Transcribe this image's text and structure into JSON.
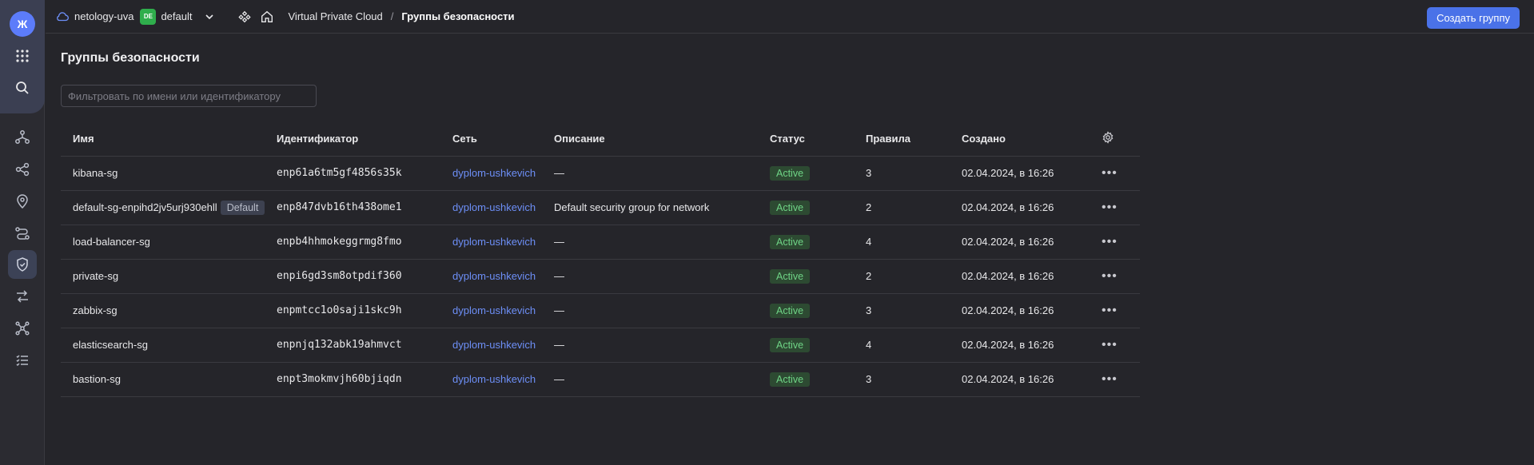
{
  "header": {
    "cloud_name": "netology-uva",
    "folder_badge": "DE",
    "folder_name": "default",
    "breadcrumb_service": "Virtual Private Cloud",
    "breadcrumb_sep": "/",
    "breadcrumb_page": "Группы безопасности",
    "create_button": "Создать группу"
  },
  "rail": {
    "logo": "Ж"
  },
  "main": {
    "title": "Группы безопасности",
    "filter_placeholder": "Фильтровать по имени или идентификатору"
  },
  "table": {
    "columns": [
      "Имя",
      "Идентификатор",
      "Сеть",
      "Описание",
      "Статус",
      "Правила",
      "Создано"
    ],
    "rows": [
      {
        "name": "kibana-sg",
        "badge": "",
        "id": "enp61a6tm5gf4856s35k",
        "network": "dyplom-ushkevich",
        "description": "—",
        "status": "Active",
        "rules": "3",
        "created": "02.04.2024, в 16:26"
      },
      {
        "name": "default-sg-enpihd2jv5urj930ehll",
        "badge": "Default",
        "id": "enp847dvb16th438ome1",
        "network": "dyplom-ushkevich",
        "description": "Default security group for network",
        "status": "Active",
        "rules": "2",
        "created": "02.04.2024, в 16:26"
      },
      {
        "name": "load-balancer-sg",
        "badge": "",
        "id": "enpb4hhmokeggrmg8fmo",
        "network": "dyplom-ushkevich",
        "description": "—",
        "status": "Active",
        "rules": "4",
        "created": "02.04.2024, в 16:26"
      },
      {
        "name": "private-sg",
        "badge": "",
        "id": "enpi6gd3sm8otpdif360",
        "network": "dyplom-ushkevich",
        "description": "—",
        "status": "Active",
        "rules": "2",
        "created": "02.04.2024, в 16:26"
      },
      {
        "name": "zabbix-sg",
        "badge": "",
        "id": "enpmtcc1o0saji1skc9h",
        "network": "dyplom-ushkevich",
        "description": "—",
        "status": "Active",
        "rules": "3",
        "created": "02.04.2024, в 16:26"
      },
      {
        "name": "elasticsearch-sg",
        "badge": "",
        "id": "enpnjq132abk19ahmvct",
        "network": "dyplom-ushkevich",
        "description": "—",
        "status": "Active",
        "rules": "4",
        "created": "02.04.2024, в 16:26"
      },
      {
        "name": "bastion-sg",
        "badge": "",
        "id": "enpt3mokmvjh60bjiqdn",
        "network": "dyplom-ushkevich",
        "description": "—",
        "status": "Active",
        "rules": "3",
        "created": "02.04.2024, в 16:26"
      }
    ],
    "row_menu": "•••"
  },
  "icons": [
    "cloud-icon",
    "chevron-down-icon",
    "services-icon",
    "home-icon",
    "grid-icon",
    "search-icon",
    "network-icon",
    "share-icon",
    "location-icon",
    "route-icon",
    "shield-icon",
    "transfer-icon",
    "nodes-icon",
    "list-icon",
    "gear-icon"
  ],
  "colors": {
    "accent": "#4a72e8",
    "status_active": "#6fd486",
    "link": "#6d8ff7",
    "folder_badge": "#2fae4c"
  }
}
